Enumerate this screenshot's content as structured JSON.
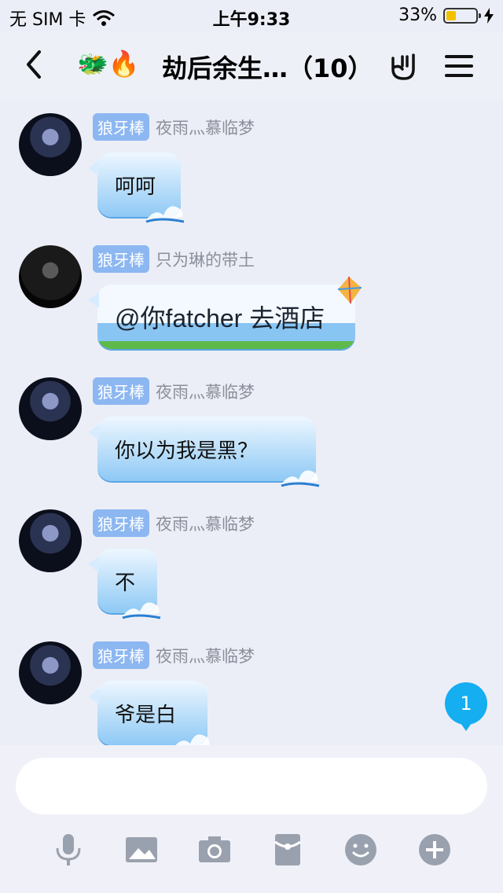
{
  "status_bar": {
    "carrier": "无 SIM 卡",
    "time": "上午9:33",
    "battery_percent": "33%"
  },
  "nav": {
    "title": "劫后余生…（10）",
    "emoji": "🐲🔥"
  },
  "messages": [
    {
      "badge": "狼牙棒",
      "nickname": "夜雨灬慕临梦",
      "text": "呵呵"
    },
    {
      "badge": "狼牙棒",
      "nickname": "只为琳的带土",
      "text": "@你fatcher 去酒店"
    },
    {
      "badge": "狼牙棒",
      "nickname": "夜雨灬慕临梦",
      "text": "你以为我是黑？"
    },
    {
      "badge": "狼牙棒",
      "nickname": "夜雨灬慕临梦",
      "text": "不"
    },
    {
      "badge": "狼牙棒",
      "nickname": "夜雨灬慕临梦",
      "text": "爷是白"
    }
  ],
  "unread_count": "1",
  "toolbar": {
    "icons": [
      "microphone-icon",
      "image-icon",
      "camera-icon",
      "red-packet-icon",
      "emoji-icon",
      "plus-icon"
    ]
  }
}
